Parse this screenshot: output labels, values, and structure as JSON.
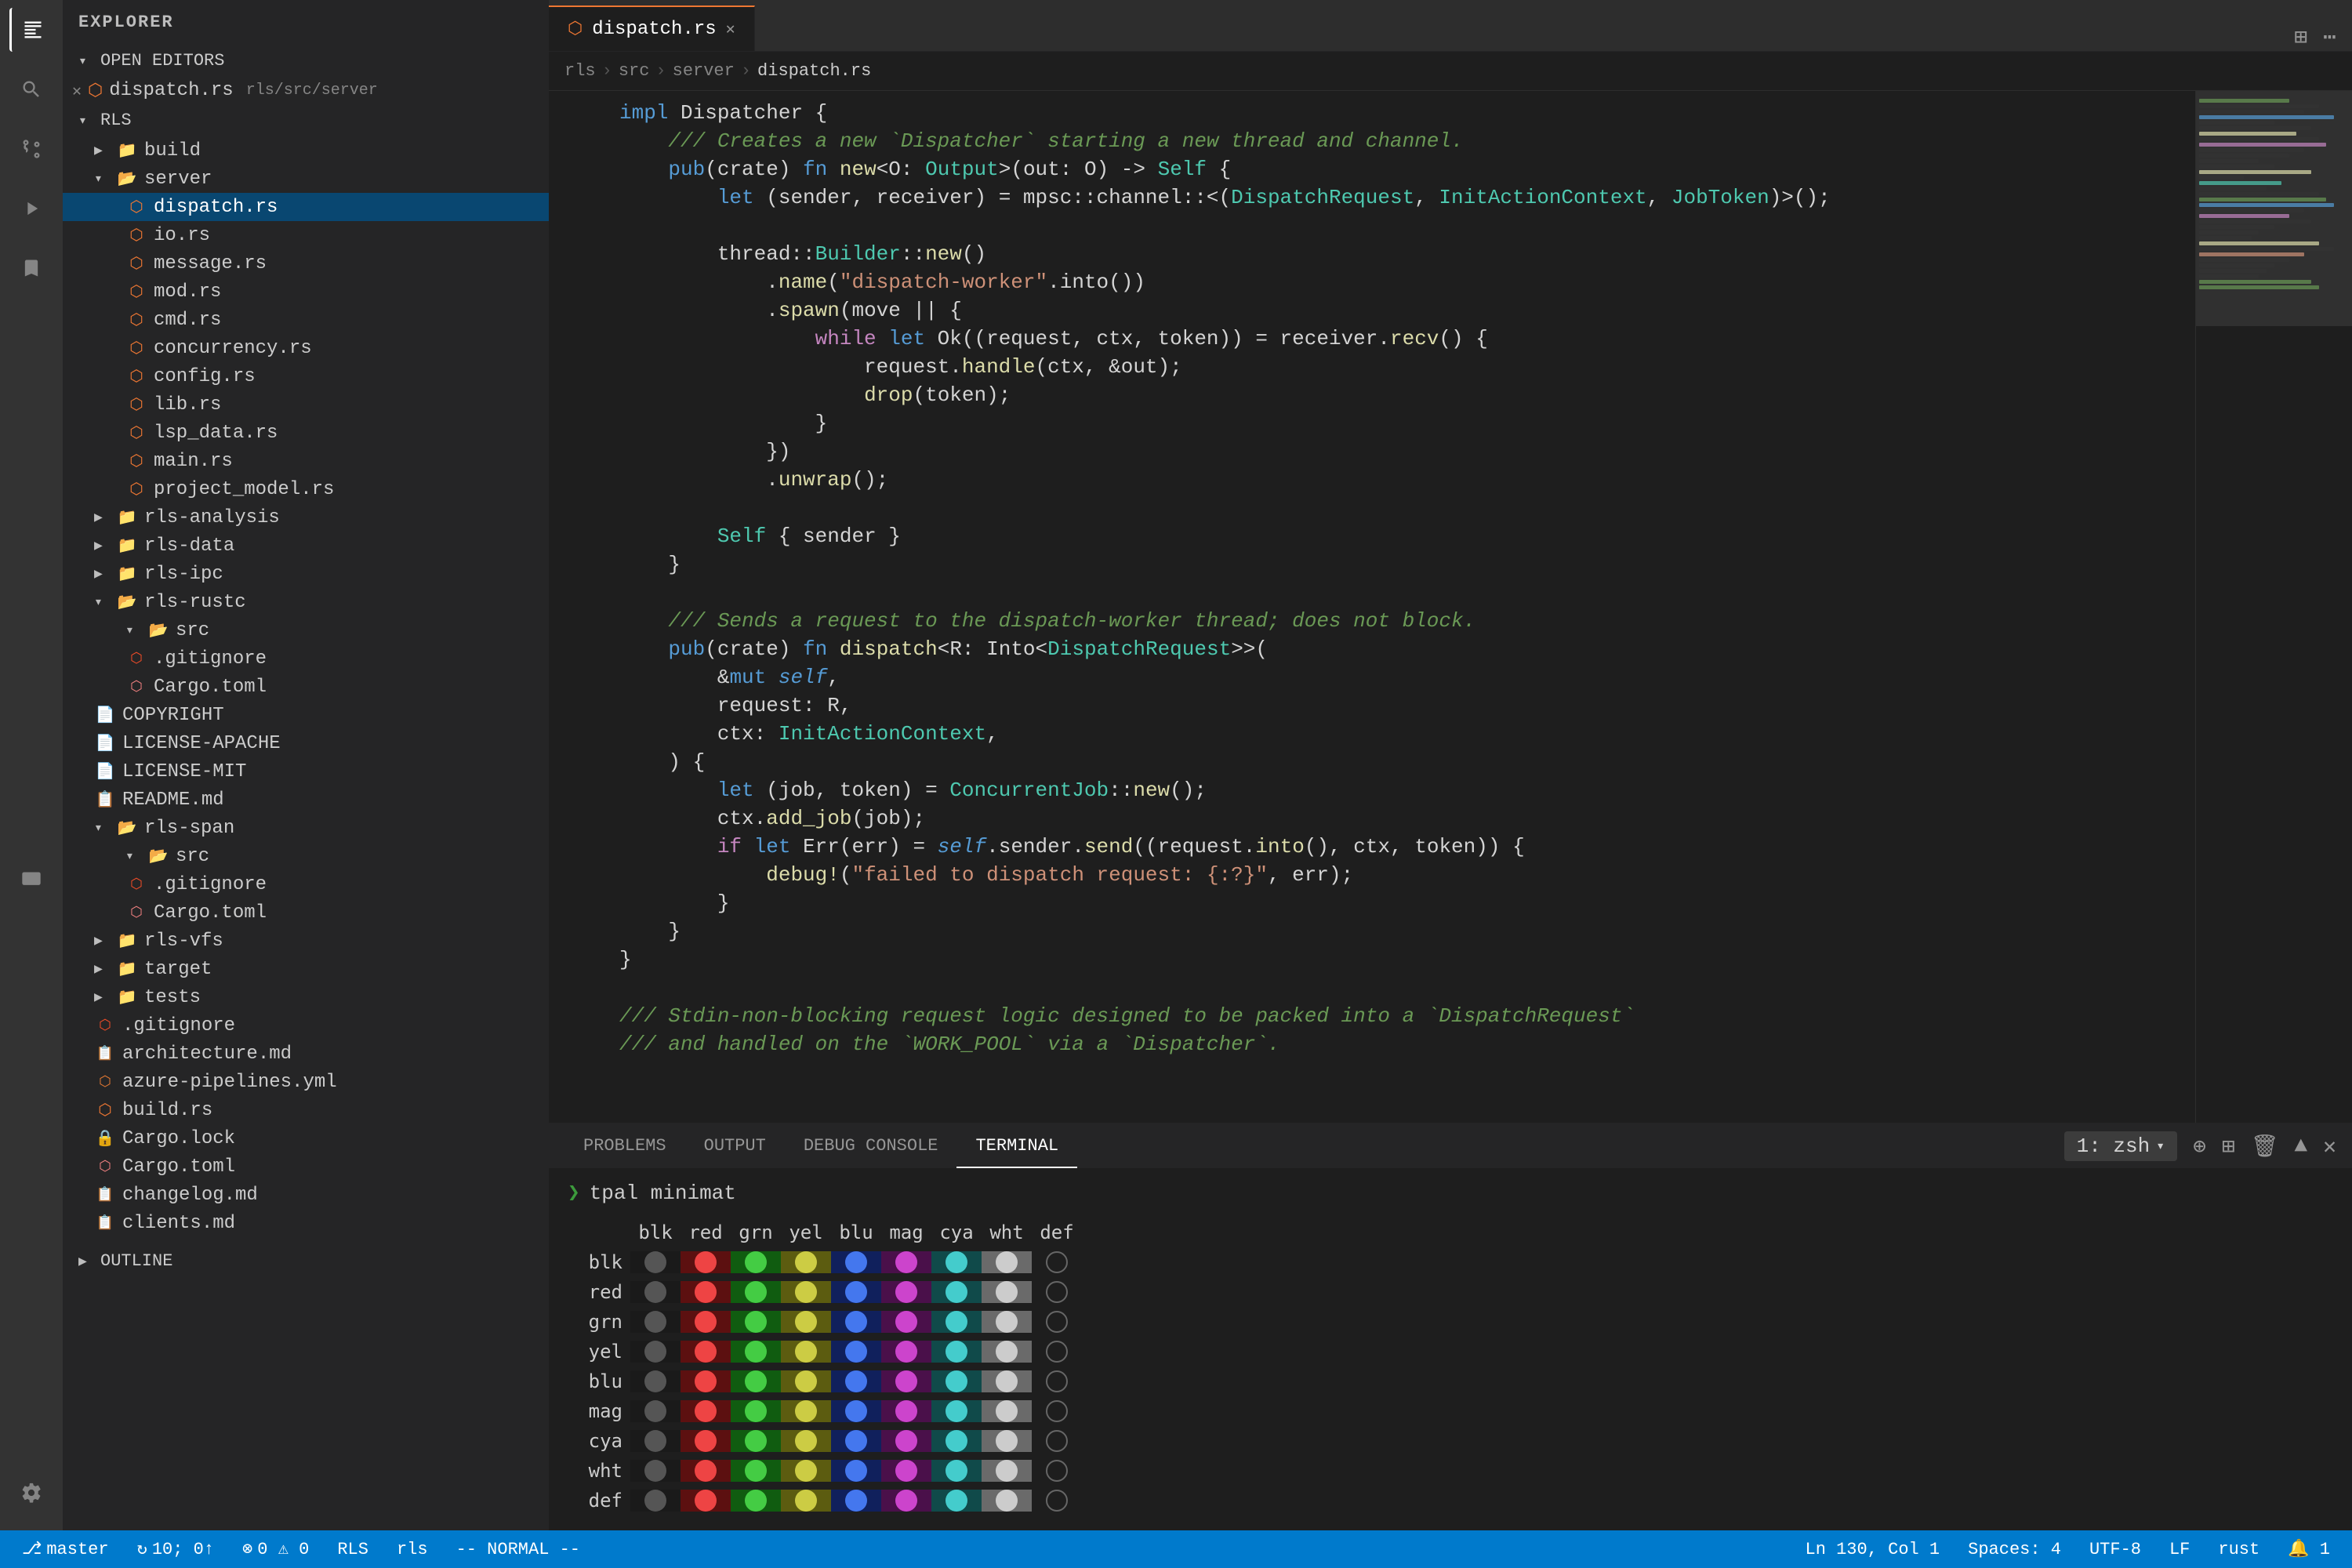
{
  "titlebar": {
    "title": "dispatch.rs"
  },
  "activity": {
    "icons": [
      "explorer",
      "search",
      "source-control",
      "run",
      "extensions",
      "remote-explorer",
      "settings"
    ]
  },
  "sidebar": {
    "title": "EXPLORER",
    "open_editors_label": "OPEN EDITORS",
    "open_editors": [
      {
        "icon": "rust",
        "name": "dispatch.rs",
        "path": "rls/src/server"
      }
    ],
    "rls_label": "RLS",
    "tree": [
      {
        "label": "build",
        "type": "folder",
        "indent": 1,
        "expanded": false
      },
      {
        "label": "server",
        "type": "folder-open",
        "indent": 1,
        "expanded": true
      },
      {
        "label": "dispatch.rs",
        "type": "rust",
        "indent": 2,
        "active": true
      },
      {
        "label": "io.rs",
        "type": "rust",
        "indent": 2
      },
      {
        "label": "message.rs",
        "type": "rust",
        "indent": 2
      },
      {
        "label": "mod.rs",
        "type": "rust",
        "indent": 2
      },
      {
        "label": "cmd.rs",
        "type": "rust",
        "indent": 2
      },
      {
        "label": "concurrency.rs",
        "type": "rust",
        "indent": 2
      },
      {
        "label": "config.rs",
        "type": "rust",
        "indent": 2
      },
      {
        "label": "lib.rs",
        "type": "rust",
        "indent": 2
      },
      {
        "label": "lsp_data.rs",
        "type": "rust",
        "indent": 2
      },
      {
        "label": "main.rs",
        "type": "rust",
        "indent": 2
      },
      {
        "label": "project_model.rs",
        "type": "rust",
        "indent": 2
      },
      {
        "label": "rls-analysis",
        "type": "folder",
        "indent": 1,
        "expanded": false
      },
      {
        "label": "rls-data",
        "type": "folder",
        "indent": 1,
        "expanded": false
      },
      {
        "label": "rls-ipc",
        "type": "folder",
        "indent": 1,
        "expanded": false
      },
      {
        "label": "rls-rustc",
        "type": "folder-open",
        "indent": 1,
        "expanded": true
      },
      {
        "label": "src",
        "type": "folder-open",
        "indent": 2,
        "expanded": true
      },
      {
        "label": ".gitignore",
        "type": "git",
        "indent": 2
      },
      {
        "label": "Cargo.toml",
        "type": "toml",
        "indent": 2
      },
      {
        "label": "COPYRIGHT",
        "type": "file",
        "indent": 1
      },
      {
        "label": "LICENSE-APACHE",
        "type": "file",
        "indent": 1
      },
      {
        "label": "LICENSE-MIT",
        "type": "file",
        "indent": 1
      },
      {
        "label": "README.md",
        "type": "md",
        "indent": 1
      },
      {
        "label": "rls-span",
        "type": "folder-open",
        "indent": 1,
        "expanded": true
      },
      {
        "label": "src",
        "type": "folder-open",
        "indent": 2
      },
      {
        "label": ".gitignore",
        "type": "git",
        "indent": 2
      },
      {
        "label": "Cargo.toml",
        "type": "toml",
        "indent": 2
      },
      {
        "label": "rls-vfs",
        "type": "folder",
        "indent": 1
      },
      {
        "label": "target",
        "type": "folder",
        "indent": 1
      },
      {
        "label": "tests",
        "type": "folder",
        "indent": 1
      },
      {
        "label": ".gitignore",
        "type": "git",
        "indent": 1
      },
      {
        "label": "architecture.md",
        "type": "md",
        "indent": 1
      },
      {
        "label": "azure-pipelines.yml",
        "type": "yml",
        "indent": 1
      },
      {
        "label": "build.rs",
        "type": "rust",
        "indent": 1
      },
      {
        "label": "Cargo.lock",
        "type": "lock",
        "indent": 1
      },
      {
        "label": "Cargo.toml",
        "type": "toml",
        "indent": 1
      },
      {
        "label": "changelog.md",
        "type": "md",
        "indent": 1
      },
      {
        "label": "clients.md",
        "type": "md",
        "indent": 1
      }
    ],
    "outline_label": "OUTLINE"
  },
  "editor": {
    "tab": {
      "label": "dispatch.rs",
      "close": "×"
    },
    "breadcrumb": [
      "rls",
      "src",
      "server",
      "dispatch.rs"
    ],
    "code_lines": [
      {
        "num": "",
        "text": "impl Dispatcher {",
        "tokens": [
          {
            "t": "kw",
            "v": "impl"
          },
          {
            "t": "",
            "v": " Dispatcher {"
          }
        ]
      },
      {
        "num": "",
        "text": "    /// Creates a new `Dispatcher` starting a new thread and channel.",
        "tokens": [
          {
            "t": "comment",
            "v": "    /// Creates a new `Dispatcher` starting a new thread and channel."
          }
        ]
      },
      {
        "num": "",
        "text": "    pub(crate) fn new<O: Output>(out: O) -> Self {",
        "tokens": [
          {
            "t": "kw",
            "v": "    pub"
          },
          {
            "t": "",
            "v": "(crate) "
          },
          {
            "t": "kw",
            "v": "fn"
          },
          {
            "t": "",
            "v": " "
          },
          {
            "t": "fn-name",
            "v": "new"
          },
          {
            "t": "",
            "v": "<O: "
          },
          {
            "t": "type",
            "v": "Output"
          },
          {
            "t": "",
            "v": ">(out: O) -> "
          },
          {
            "t": "type",
            "v": "Self"
          },
          {
            "t": "",
            "v": " {"
          }
        ]
      },
      {
        "num": "",
        "text": "        let (sender, receiver) = mpsc::channel::<(DispatchRequest, InitActionContext, JobToken)>();",
        "tokens": [
          {
            "t": "kw",
            "v": "        let"
          },
          {
            "t": "",
            "v": " (sender, receiver) = mpsc::channel::<("
          },
          {
            "t": "type",
            "v": "DispatchRequest"
          },
          {
            "t": "",
            "v": ", "
          },
          {
            "t": "type",
            "v": "InitActionContext"
          },
          {
            "t": "",
            "v": ", "
          },
          {
            "t": "type",
            "v": "JobToken"
          },
          {
            "t": "",
            "v": "         )>();"
          }
        ]
      },
      {
        "num": "",
        "text": ""
      },
      {
        "num": "",
        "text": "        thread::Builder::new()",
        "tokens": [
          {
            "t": "",
            "v": "        thread::"
          },
          {
            "t": "type",
            "v": "Builder"
          },
          {
            "t": "",
            "v": "::"
          },
          {
            "t": "fn-name",
            "v": "new"
          },
          {
            "t": "",
            "v": "()"
          }
        ]
      },
      {
        "num": "",
        "text": "            .name(\"dispatch-worker\".into())",
        "tokens": [
          {
            "t": "",
            "v": "            ."
          },
          {
            "t": "fn-name",
            "v": "name"
          },
          {
            "t": "",
            "v": "("
          },
          {
            "t": "string",
            "v": "\"dispatch-worker\""
          },
          {
            "t": "",
            "v": ".into())"
          }
        ]
      },
      {
        "num": "",
        "text": "            .spawn(move || {",
        "tokens": [
          {
            "t": "",
            "v": "            ."
          },
          {
            "t": "fn-name",
            "v": "spawn"
          },
          {
            "t": "",
            "v": "(move || {"
          }
        ]
      },
      {
        "num": "",
        "text": "                while let Ok((request, ctx, token)) = receiver.recv() {",
        "tokens": [
          {
            "t": "kw2",
            "v": "                while"
          },
          {
            "t": "",
            "v": " "
          },
          {
            "t": "kw",
            "v": "let"
          },
          {
            "t": "",
            "v": " Ok((request, ctx, token)) = receiver."
          },
          {
            "t": "fn-name",
            "v": "recv"
          },
          {
            "t": "",
            "v": "() {"
          }
        ]
      },
      {
        "num": "",
        "text": "                    request.handle(ctx, &out);",
        "tokens": [
          {
            "t": "",
            "v": "                    request."
          },
          {
            "t": "fn-name",
            "v": "handle"
          },
          {
            "t": "",
            "v": "(ctx, &out);"
          }
        ]
      },
      {
        "num": "",
        "text": "                    drop(token);",
        "tokens": [
          {
            "t": "",
            "v": "                    "
          },
          {
            "t": "fn-name",
            "v": "drop"
          },
          {
            "t": "",
            "v": "(token);"
          }
        ]
      },
      {
        "num": "",
        "text": "                }",
        "tokens": [
          {
            "t": "",
            "v": "                }"
          }
        ]
      },
      {
        "num": "",
        "text": "            })",
        "tokens": [
          {
            "t": "",
            "v": "            })"
          }
        ]
      },
      {
        "num": "",
        "text": "            .unwrap();",
        "tokens": [
          {
            "t": "",
            "v": "            ."
          },
          {
            "t": "fn-name",
            "v": "unwrap"
          },
          {
            "t": "",
            "v": "();"
          }
        ]
      },
      {
        "num": "",
        "text": ""
      },
      {
        "num": "",
        "text": "        Self { sender }",
        "tokens": [
          {
            "t": "type",
            "v": "        Self"
          },
          {
            "t": "",
            "v": " { sender }"
          }
        ]
      },
      {
        "num": "",
        "text": "    }",
        "tokens": [
          {
            "t": "",
            "v": "    }"
          }
        ]
      },
      {
        "num": "",
        "text": ""
      },
      {
        "num": "",
        "text": "    /// Sends a request to the dispatch-worker thread; does not block.",
        "tokens": [
          {
            "t": "comment",
            "v": "    /// Sends a request to the dispatch-worker thread; does not block."
          }
        ]
      },
      {
        "num": "",
        "text": "    pub(crate) fn dispatch<R: Into<DispatchRequest>>(",
        "tokens": [
          {
            "t": "kw",
            "v": "    pub"
          },
          {
            "t": "",
            "v": "(crate) "
          },
          {
            "t": "kw",
            "v": "fn"
          },
          {
            "t": "",
            "v": " "
          },
          {
            "t": "fn-name",
            "v": "dispatch"
          },
          {
            "t": "",
            "v": "<R: Into<"
          },
          {
            "t": "type",
            "v": "DispatchRequest"
          },
          {
            "t": "",
            "v": ">>("
          }
        ]
      },
      {
        "num": "",
        "text": "        &mut self,",
        "tokens": [
          {
            "t": "",
            "v": "        &"
          },
          {
            "t": "kw",
            "v": "mut"
          },
          {
            "t": "",
            "v": " "
          },
          {
            "t": "self-kw",
            "v": "self"
          },
          {
            "t": "",
            "v": ","
          }
        ]
      },
      {
        "num": "",
        "text": "        request: R,",
        "tokens": [
          {
            "t": "",
            "v": "        request: R,"
          }
        ]
      },
      {
        "num": "",
        "text": "        ctx: InitActionContext,",
        "tokens": [
          {
            "t": "",
            "v": "        ctx: "
          },
          {
            "t": "type",
            "v": "InitActionContext"
          },
          {
            "t": "",
            "v": ","
          }
        ]
      },
      {
        "num": "",
        "text": "    ) {",
        "tokens": [
          {
            "t": "",
            "v": "    ) {"
          }
        ]
      },
      {
        "num": "",
        "text": "        let (job, token) = ConcurrentJob::new();",
        "tokens": [
          {
            "t": "kw",
            "v": "        let"
          },
          {
            "t": "",
            "v": " (job, token) = "
          },
          {
            "t": "type",
            "v": "ConcurrentJob"
          },
          {
            "t": "",
            "v": "::"
          },
          {
            "t": "fn-name",
            "v": "new"
          },
          {
            "t": "",
            "v": "();"
          }
        ]
      },
      {
        "num": "",
        "text": "        ctx.add_job(job);",
        "tokens": [
          {
            "t": "",
            "v": "        ctx."
          },
          {
            "t": "fn-name",
            "v": "add_job"
          },
          {
            "t": "",
            "v": "(job);"
          }
        ]
      },
      {
        "num": "",
        "text": "        if let Err(err) = self.sender.send((request.into(), ctx, token)) {",
        "tokens": [
          {
            "t": "kw2",
            "v": "        if"
          },
          {
            "t": "",
            "v": " "
          },
          {
            "t": "kw",
            "v": "let"
          },
          {
            "t": "",
            "v": " Err(err) = "
          },
          {
            "t": "self-kw",
            "v": "self"
          },
          {
            "t": "",
            "v": ".sender."
          },
          {
            "t": "fn-name",
            "v": "send"
          },
          {
            "t": "",
            "v": "((request."
          },
          {
            "t": "fn-name",
            "v": "into"
          },
          {
            "t": "",
            "v": "(), ctx, token)) {"
          }
        ]
      },
      {
        "num": "",
        "text": "            debug!(\"failed to dispatch request: {:?}\", err);",
        "tokens": [
          {
            "t": "macro",
            "v": "            debug!"
          },
          {
            "t": "",
            "v": "("
          },
          {
            "t": "string",
            "v": "\"failed to dispatch request: {:?}\""
          },
          {
            "t": "",
            "v": ", err);"
          }
        ]
      },
      {
        "num": "",
        "text": "        }",
        "tokens": [
          {
            "t": "",
            "v": "        }"
          }
        ]
      },
      {
        "num": "",
        "text": "    }",
        "tokens": [
          {
            "t": "",
            "v": "    }"
          }
        ]
      },
      {
        "num": "",
        "text": "}",
        "tokens": [
          {
            "t": "",
            "v": "}"
          }
        ]
      },
      {
        "num": "",
        "text": ""
      },
      {
        "num": "",
        "text": "/// Stdin-non-blocking request logic designed to be packed into a `DispatchRequest`",
        "tokens": [
          {
            "t": "comment",
            "v": "/// Stdin-non-blocking request logic designed to be packed into a `DispatchRequest`"
          }
        ]
      },
      {
        "num": "",
        "text": "/// and handled on the `WORK_POOL` via a `Dispatcher`.",
        "tokens": [
          {
            "t": "comment",
            "v": "/// and handled on the `WORK_POOL` via a `Dispatcher`."
          }
        ]
      }
    ]
  },
  "panel": {
    "tabs": [
      "PROBLEMS",
      "OUTPUT",
      "DEBUG CONSOLE",
      "TERMINAL"
    ],
    "active_tab": "TERMINAL",
    "terminal_label": "1: zsh",
    "prompt_cmd": "tpal minimat",
    "color_table": {
      "headers": [
        "blk",
        "red",
        "grn",
        "yel",
        "blu",
        "mag",
        "cya",
        "wht",
        "def"
      ],
      "rows": [
        {
          "label": "blk",
          "colors": [
            "#4a4a4a",
            "#cc3333",
            "#33aa33",
            "#aaaa33",
            "#3366bb",
            "#aa33aa",
            "#33aaaa",
            "#aaaaaa",
            null
          ]
        },
        {
          "label": "red",
          "colors": [
            "#cc3333",
            "#cc3333",
            "#33aa33",
            "#aaaa33",
            "#3366bb",
            "#aa33aa",
            "#33aaaa",
            "#aaaaaa",
            null
          ]
        },
        {
          "label": "grn",
          "colors": [
            "#4a4a4a",
            "#cc3333",
            "#33aa33",
            "#aaaa33",
            "#3366bb",
            "#aa33aa",
            "#33aaaa",
            "#aaaaaa",
            null
          ]
        },
        {
          "label": "yel",
          "colors": [
            "#4a4a4a",
            "#cc3333",
            "#33aa33",
            "#aaaa33",
            "#3366bb",
            "#aa33aa",
            "#33aaaa",
            "#aaaaaa",
            null
          ]
        },
        {
          "label": "blu",
          "colors": [
            "#4a4a4a",
            "#cc3333",
            "#33aa33",
            "#aaaa33",
            "#3366bb",
            "#aa33aa",
            "#33aaaa",
            "#aaaaaa",
            null
          ]
        },
        {
          "label": "mag",
          "colors": [
            "#4a4a4a",
            "#cc3333",
            "#33aa33",
            "#aaaa33",
            "#3366bb",
            "#aa33aa",
            "#33aaaa",
            "#aaaaaa",
            null
          ]
        },
        {
          "label": "cya",
          "colors": [
            "#4a4a4a",
            "#cc3333",
            "#33aa33",
            "#aaaa33",
            "#3366bb",
            "#aa33aa",
            "#33aaaa",
            "#aaaaaa",
            null
          ]
        },
        {
          "label": "wht",
          "colors": [
            "#4a4a4a",
            "#cc3333",
            "#33aa33",
            "#aaaa33",
            "#3366bb",
            "#aa33aa",
            "#33aaaa",
            "#aaaaaa",
            null
          ]
        },
        {
          "label": "def",
          "colors": [
            "#4a4a4a",
            "#cc3333",
            "#33aa33",
            "#aaaa33",
            "#3366bb",
            "#aa33aa",
            "#33aaaa",
            "#aaaaaa",
            null
          ]
        }
      ]
    }
  },
  "status_bar": {
    "branch": "master",
    "sync": "10; 0↑",
    "errors": "0 ⚠ 0",
    "rls": "RLS",
    "rls_path": "rls",
    "mode": "-- NORMAL --",
    "right": {
      "ln_col": "Ln 130, Col 1",
      "spaces": "Spaces: 4",
      "encoding": "UTF-8",
      "line_ending": "LF",
      "language": "rust",
      "notification": "🔔 1"
    }
  }
}
